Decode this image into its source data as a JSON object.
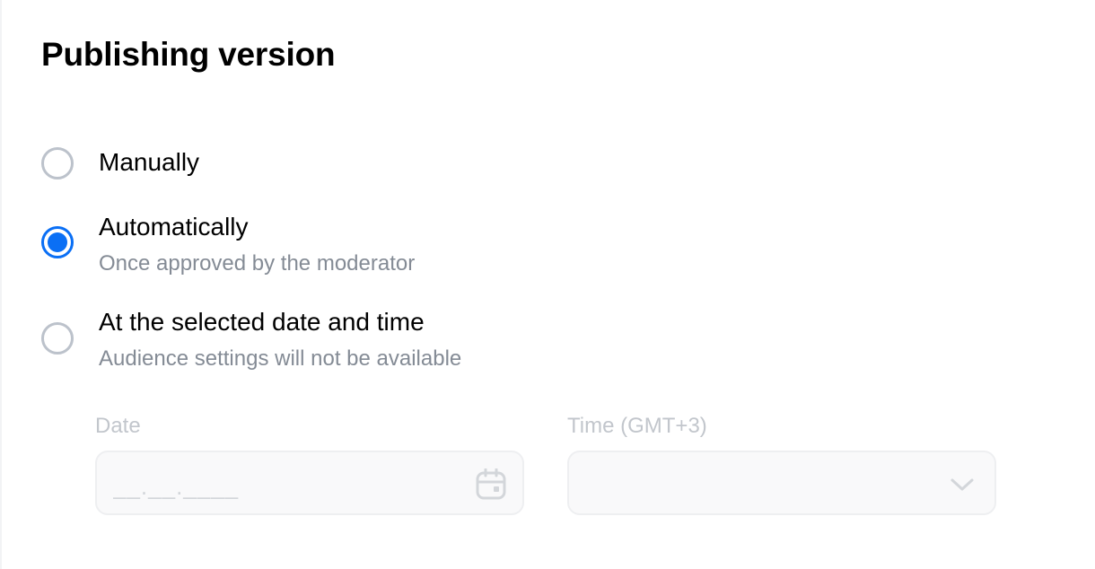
{
  "header": {
    "title": "Publishing version"
  },
  "options": [
    {
      "label": "Manually",
      "sublabel": "",
      "checked": false
    },
    {
      "label": "Automatically",
      "sublabel": "Once approved by the moderator",
      "checked": true
    },
    {
      "label": "At the selected date and time",
      "sublabel": "Audience settings will not be available",
      "checked": false
    }
  ],
  "schedule": {
    "date_label": "Date",
    "date_placeholder": "__.__.____",
    "date_value": "",
    "time_label": "Time (GMT+3)",
    "time_value": ""
  },
  "icons": {
    "date": "calendar-icon",
    "time": "chevron-down-icon"
  },
  "colors": {
    "accent": "#0a6ff5",
    "radio_border": "#bcc2cb",
    "secondary_text": "#848b95",
    "disabled_text": "#c2c6cc",
    "field_background": "#f9f9fa",
    "field_border": "#eeeff1"
  }
}
